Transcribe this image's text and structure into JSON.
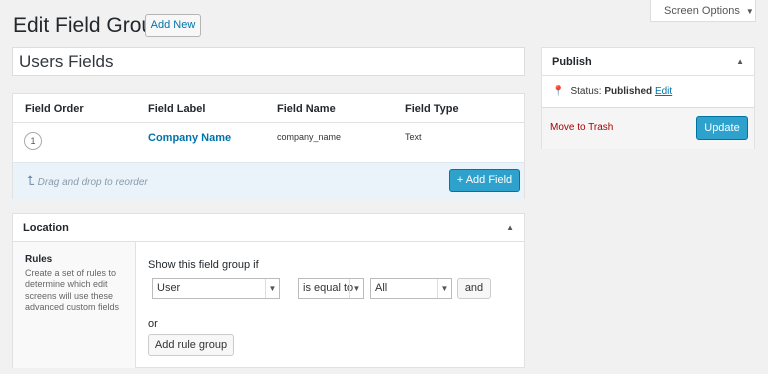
{
  "header": {
    "title": "Edit Field Group",
    "add_new_label": "Add New",
    "screen_options_label": "Screen Options"
  },
  "group_title": "Users Fields",
  "fields_table": {
    "columns": [
      "Field Order",
      "Field Label",
      "Field Name",
      "Field Type"
    ],
    "rows": [
      {
        "order": "1",
        "label": "Company Name",
        "name": "company_name",
        "type": "Text"
      }
    ],
    "drag_hint": "Drag and drop to reorder",
    "add_field_label": "+ Add Field"
  },
  "location": {
    "title": "Location",
    "rules_title": "Rules",
    "rules_desc": "Create a set of rules to determine which edit screens will use these advanced custom fields",
    "show_label": "Show this field group if",
    "param_value": "User",
    "operator_value": "is equal to",
    "value_value": "All",
    "and_label": "and",
    "or_label": "or",
    "add_rule_group_label": "Add rule group"
  },
  "publish": {
    "title": "Publish",
    "status_label": "Status:",
    "status_value": "Published",
    "edit_label": "Edit",
    "trash_label": "Move to Trash",
    "update_label": "Update"
  }
}
